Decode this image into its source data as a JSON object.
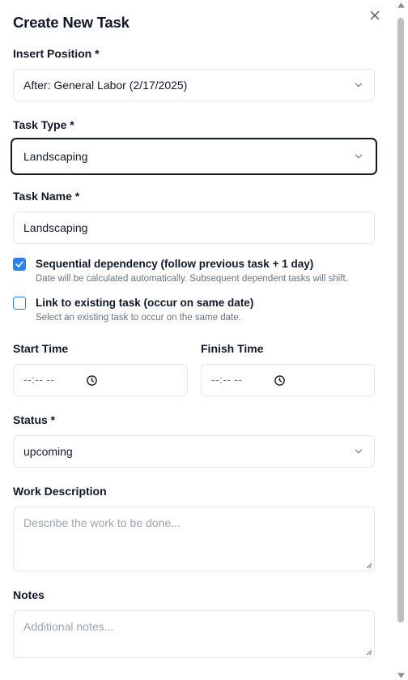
{
  "dialog": {
    "title": "Create New Task",
    "close_icon": "close-icon"
  },
  "insert_position": {
    "label": "Insert Position *",
    "value": "After: General Labor (2/17/2025)"
  },
  "task_type": {
    "label": "Task Type *",
    "value": "Landscaping"
  },
  "task_name": {
    "label": "Task Name *",
    "value": "Landscaping"
  },
  "sequential": {
    "checked": true,
    "label": "Sequential dependency (follow previous task + 1 day)",
    "help": "Date will be calculated automatically. Subsequent dependent tasks will shift."
  },
  "link_existing": {
    "checked": false,
    "label": "Link to existing task (occur on same date)",
    "help": "Select an existing task to occur on the same date."
  },
  "start_time": {
    "label": "Start Time",
    "value": "--:-- --"
  },
  "finish_time": {
    "label": "Finish Time",
    "value": "--:-- --"
  },
  "status": {
    "label": "Status *",
    "value": "upcoming"
  },
  "work_description": {
    "label": "Work Description",
    "placeholder": "Describe the work to be done..."
  },
  "notes": {
    "label": "Notes",
    "placeholder": "Additional notes..."
  },
  "colors": {
    "accent": "#2f80ed",
    "text": "#111827",
    "muted": "#6b7280",
    "border": "#e5e7eb"
  }
}
